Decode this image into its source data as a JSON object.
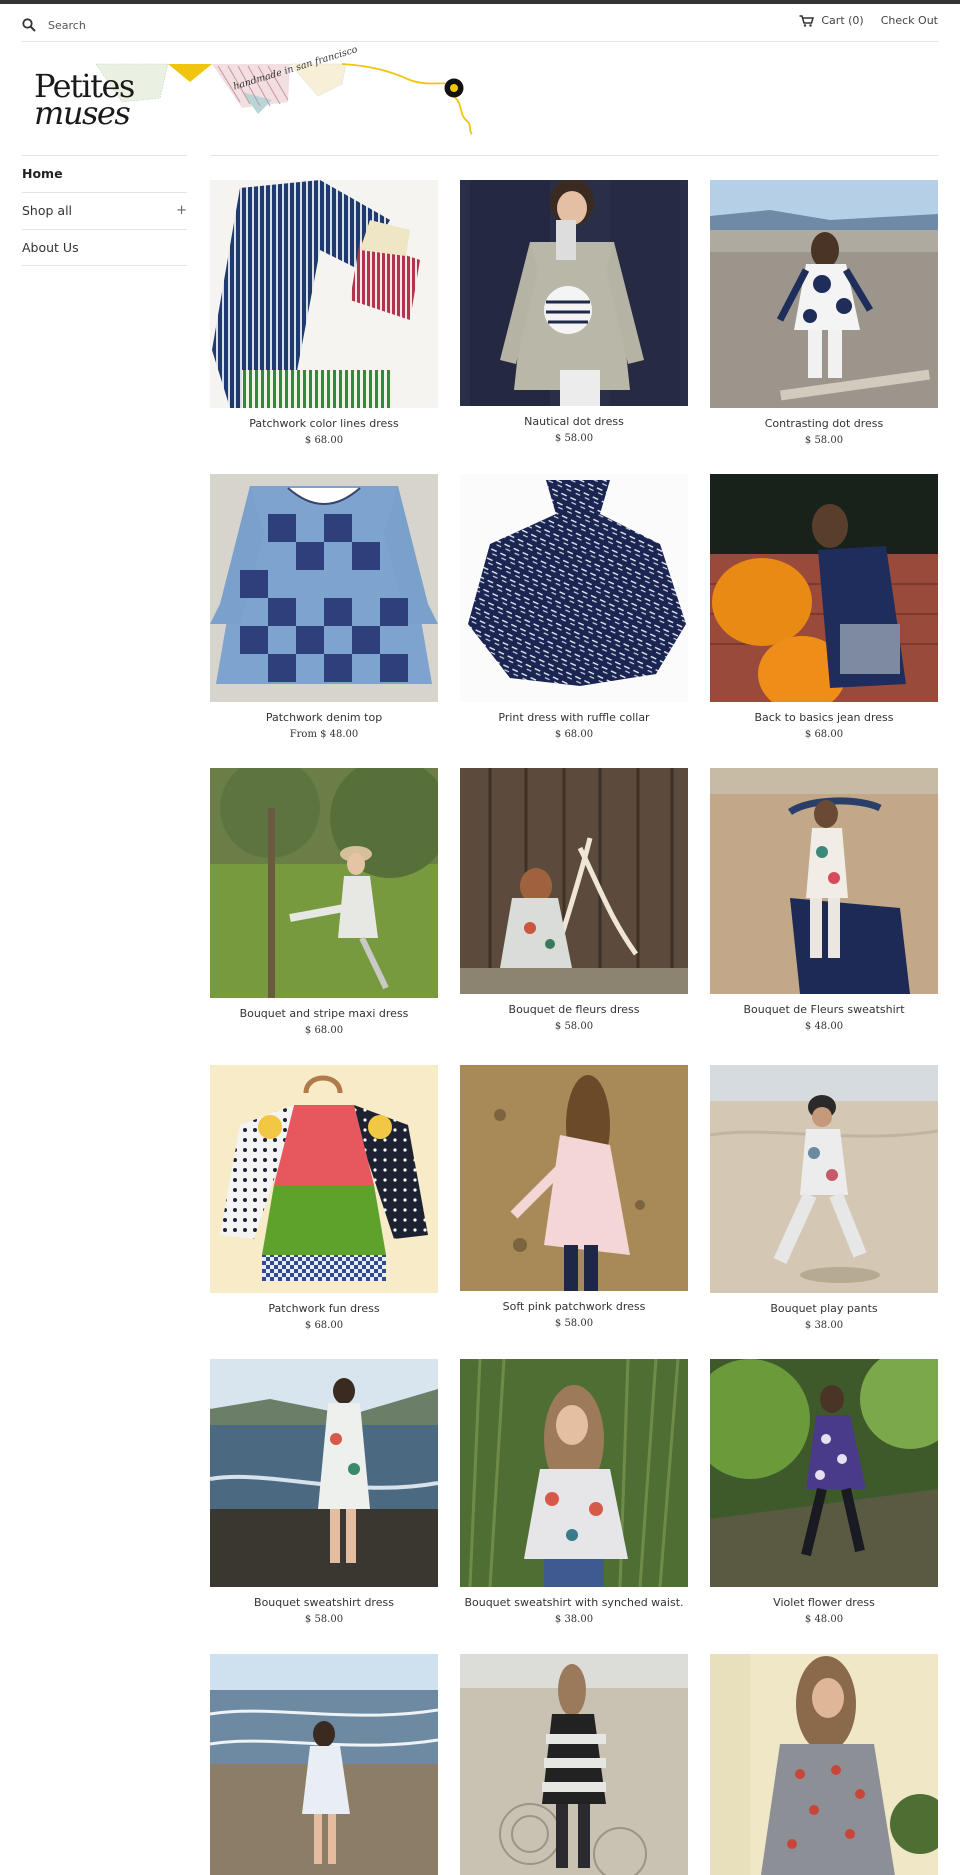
{
  "header": {
    "search_placeholder": "Search",
    "cart_label": "Cart (0)",
    "checkout_label": "Check Out"
  },
  "logo": {
    "line1": "Petites",
    "line2": "muses",
    "tagline": "handmade in san francisco"
  },
  "sidebar": {
    "items": [
      {
        "label": "Home",
        "active": true
      },
      {
        "label": "Shop all",
        "expander": "+"
      },
      {
        "label": "About Us"
      }
    ]
  },
  "products": [
    {
      "title": "Patchwork color lines dress",
      "price": "$ 68.00"
    },
    {
      "title": "Nautical dot dress",
      "price": "$ 58.00"
    },
    {
      "title": "Contrasting dot dress",
      "price": "$ 58.00"
    },
    {
      "title": "Patchwork denim top",
      "price": "From $ 48.00"
    },
    {
      "title": "Print dress with ruffle collar",
      "price": "$ 68.00"
    },
    {
      "title": "Back to basics jean dress",
      "price": "$ 68.00"
    },
    {
      "title": "Bouquet and stripe maxi dress",
      "price": "$ 68.00"
    },
    {
      "title": "Bouquet de fleurs dress",
      "price": "$ 58.00"
    },
    {
      "title": "Bouquet de Fleurs sweatshirt",
      "price": "$ 48.00"
    },
    {
      "title": "Patchwork fun dress",
      "price": "$ 68.00"
    },
    {
      "title": "Soft pink patchwork dress",
      "price": "$ 58.00"
    },
    {
      "title": "Bouquet play pants",
      "price": "$ 38.00"
    },
    {
      "title": "Bouquet sweatshirt dress",
      "price": "$ 58.00"
    },
    {
      "title": "Bouquet sweatshirt with synched waist.",
      "price": "$ 38.00"
    },
    {
      "title": "Violet flower dress",
      "price": "$ 48.00"
    },
    {
      "title": "",
      "price": ""
    },
    {
      "title": "",
      "price": ""
    },
    {
      "title": "",
      "price": ""
    }
  ],
  "colors": {
    "topbar": "#333333",
    "divider": "#e4e4e4",
    "text": "#333333"
  }
}
